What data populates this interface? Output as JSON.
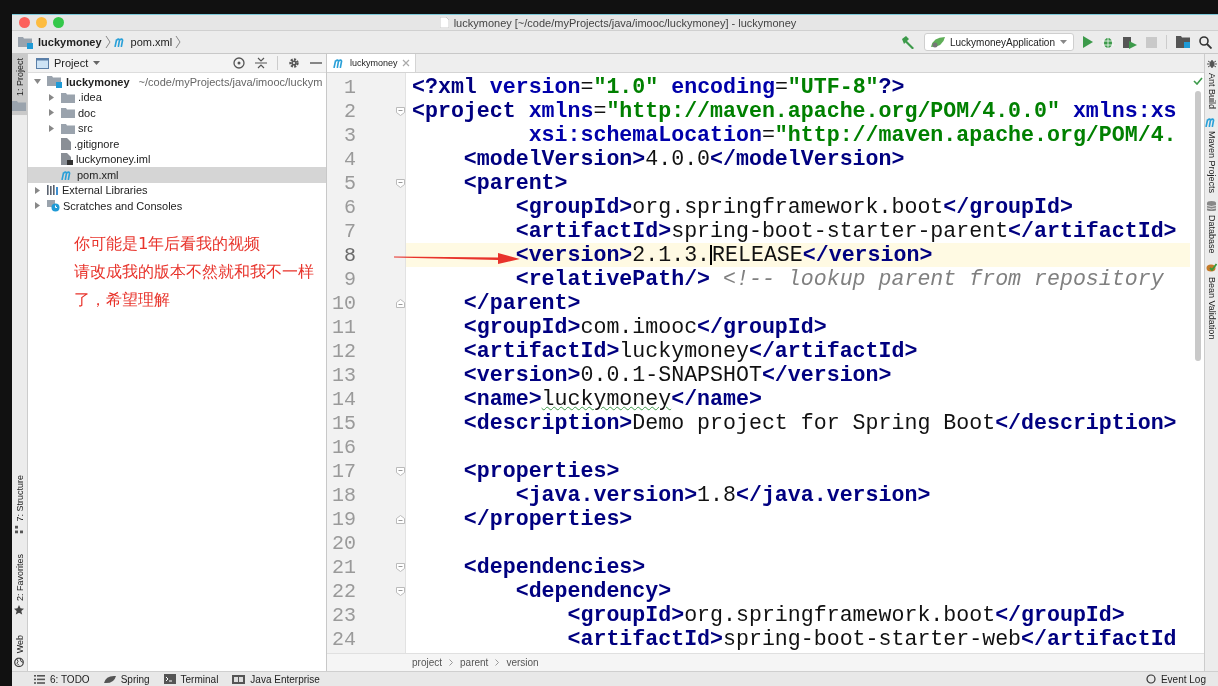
{
  "window": {
    "title": "luckymoney [~/code/myProjects/java/imooc/luckymoney] - luckymoney"
  },
  "navbar": {
    "breadcrumbs": [
      {
        "label": "luckymoney",
        "kind": "project"
      },
      {
        "label": "pom.xml",
        "kind": "maven"
      }
    ],
    "run_config": "LuckymoneyApplication"
  },
  "left_stripe": [
    {
      "label": "1: Project",
      "kind": "folder",
      "selected": true
    },
    {
      "label": "7: Structure",
      "kind": "structure",
      "selected": false
    },
    {
      "label": "2: Favorites",
      "kind": "star",
      "selected": false
    },
    {
      "label": "Web",
      "kind": "globe",
      "selected": false
    }
  ],
  "project_panel": {
    "title": "Project",
    "tree": [
      {
        "label": "luckymoney",
        "path": "~/code/myProjects/java/imooc/luckym",
        "kind": "module",
        "expanded": true,
        "selected": false,
        "children": [
          {
            "label": ".idea",
            "kind": "folder",
            "expanded": false,
            "selected": false
          },
          {
            "label": "doc",
            "kind": "folder",
            "expanded": false,
            "selected": false
          },
          {
            "label": "src",
            "kind": "folder",
            "expanded": false,
            "selected": false
          },
          {
            "label": ".gitignore",
            "kind": "text-file",
            "selected": false
          },
          {
            "label": "luckymoney.iml",
            "kind": "module-file",
            "selected": false
          },
          {
            "label": "pom.xml",
            "kind": "maven",
            "selected": true
          }
        ]
      },
      {
        "label": "External Libraries",
        "kind": "libraries",
        "expanded": false,
        "selected": false
      },
      {
        "label": "Scratches and Consoles",
        "kind": "scratches",
        "expanded": false,
        "selected": false
      }
    ]
  },
  "editor": {
    "tabs": [
      {
        "label": "luckymoney",
        "selected": true
      }
    ],
    "lines": [
      {
        "number": "1",
        "current": false,
        "fold_start": false,
        "fold_end": false,
        "segments": [
          {
            "kind": "tag",
            "text": "<?xml "
          },
          {
            "kind": "attr",
            "text": "version"
          },
          {
            "kind": "text",
            "text": "="
          },
          {
            "kind": "value",
            "text": "\"1.0\""
          },
          {
            "kind": "attr",
            "text": " encoding"
          },
          {
            "kind": "text",
            "text": "="
          },
          {
            "kind": "value",
            "text": "\"UTF-8\""
          },
          {
            "kind": "tag",
            "text": "?>"
          }
        ]
      },
      {
        "number": "2",
        "current": false,
        "fold_start": true,
        "fold_end": false,
        "segments": [
          {
            "kind": "tag",
            "text": "<project "
          },
          {
            "kind": "attr",
            "text": "xmlns"
          },
          {
            "kind": "text",
            "text": "="
          },
          {
            "kind": "value",
            "text": "\"http://maven.apache.org/POM/4.0.0\""
          },
          {
            "kind": "attr",
            "text": " xmlns:xs"
          }
        ]
      },
      {
        "number": "3",
        "current": false,
        "fold_start": false,
        "fold_end": false,
        "segments": [
          {
            "kind": "attr",
            "text": "         xsi:schemaLocation"
          },
          {
            "kind": "text",
            "text": "="
          },
          {
            "kind": "value",
            "text": "\"http://maven.apache.org/POM/4."
          }
        ]
      },
      {
        "number": "4",
        "current": false,
        "fold_start": false,
        "fold_end": false,
        "segments": [
          {
            "kind": "tag",
            "text": "    <modelVersion>"
          },
          {
            "kind": "text",
            "text": "4.0.0"
          },
          {
            "kind": "tag",
            "text": "</modelVersion>"
          }
        ]
      },
      {
        "number": "5",
        "current": false,
        "fold_start": true,
        "fold_end": false,
        "segments": [
          {
            "kind": "tag",
            "text": "    <parent>"
          }
        ]
      },
      {
        "number": "6",
        "current": false,
        "fold_start": false,
        "fold_end": false,
        "segments": [
          {
            "kind": "tag",
            "text": "        <groupId>"
          },
          {
            "kind": "text",
            "text": "org.springframework.boot"
          },
          {
            "kind": "tag",
            "text": "</groupId>"
          }
        ]
      },
      {
        "number": "7",
        "current": false,
        "fold_start": false,
        "fold_end": false,
        "segments": [
          {
            "kind": "tag",
            "text": "        <artifactId>"
          },
          {
            "kind": "text",
            "text": "spring-boot-starter-parent"
          },
          {
            "kind": "tag",
            "text": "</artifactId>"
          }
        ]
      },
      {
        "number": "8",
        "current": true,
        "fold_start": false,
        "fold_end": false,
        "segments": [
          {
            "kind": "tag",
            "text": "        <version>"
          },
          {
            "kind": "text",
            "text": "2.1.3."
          },
          {
            "kind": "caret"
          },
          {
            "kind": "text",
            "text": "RELEASE"
          },
          {
            "kind": "tag",
            "text": "</version>"
          }
        ]
      },
      {
        "number": "9",
        "current": false,
        "fold_start": false,
        "fold_end": false,
        "segments": [
          {
            "kind": "tag",
            "text": "        <relativePath/> "
          },
          {
            "kind": "comment",
            "text": "<!-- lookup parent from repository"
          }
        ]
      },
      {
        "number": "10",
        "current": false,
        "fold_start": false,
        "fold_end": true,
        "segments": [
          {
            "kind": "tag",
            "text": "    </parent>"
          }
        ]
      },
      {
        "number": "11",
        "current": false,
        "fold_start": false,
        "fold_end": false,
        "segments": [
          {
            "kind": "tag",
            "text": "    <groupId>"
          },
          {
            "kind": "text",
            "text": "com.imooc"
          },
          {
            "kind": "tag",
            "text": "</groupId>"
          }
        ]
      },
      {
        "number": "12",
        "current": false,
        "fold_start": false,
        "fold_end": false,
        "segments": [
          {
            "kind": "tag",
            "text": "    <artifactId>"
          },
          {
            "kind": "text",
            "text": "luckymoney"
          },
          {
            "kind": "tag",
            "text": "</artifactId>"
          }
        ]
      },
      {
        "number": "13",
        "current": false,
        "fold_start": false,
        "fold_end": false,
        "segments": [
          {
            "kind": "tag",
            "text": "    <version>"
          },
          {
            "kind": "text",
            "text": "0.0.1-SNAPSHOT"
          },
          {
            "kind": "tag",
            "text": "</version>"
          }
        ]
      },
      {
        "number": "14",
        "current": false,
        "fold_start": false,
        "fold_end": false,
        "segments": [
          {
            "kind": "tag",
            "text": "    <name>"
          },
          {
            "kind": "typo",
            "text": "luckymoney"
          },
          {
            "kind": "tag",
            "text": "</name>"
          }
        ]
      },
      {
        "number": "15",
        "current": false,
        "fold_start": false,
        "fold_end": false,
        "segments": [
          {
            "kind": "tag",
            "text": "    <description>"
          },
          {
            "kind": "text",
            "text": "Demo project for Spring Boot"
          },
          {
            "kind": "tag",
            "text": "</description>"
          }
        ]
      },
      {
        "number": "16",
        "current": false,
        "fold_start": false,
        "fold_end": false
      },
      {
        "number": "17",
        "current": false,
        "fold_start": true,
        "fold_end": false,
        "segments": [
          {
            "kind": "tag",
            "text": "    <properties>"
          }
        ]
      },
      {
        "number": "18",
        "current": false,
        "fold_start": false,
        "fold_end": false,
        "segments": [
          {
            "kind": "tag",
            "text": "        <java.version>"
          },
          {
            "kind": "text",
            "text": "1.8"
          },
          {
            "kind": "tag",
            "text": "</java.version>"
          }
        ]
      },
      {
        "number": "19",
        "current": false,
        "fold_start": false,
        "fold_end": true,
        "segments": [
          {
            "kind": "tag",
            "text": "    </properties>"
          }
        ]
      },
      {
        "number": "20",
        "current": false,
        "fold_start": false,
        "fold_end": false
      },
      {
        "number": "21",
        "current": false,
        "fold_start": true,
        "fold_end": false,
        "segments": [
          {
            "kind": "tag",
            "text": "    <dependencies>"
          }
        ]
      },
      {
        "number": "22",
        "current": false,
        "fold_start": true,
        "fold_end": false,
        "segments": [
          {
            "kind": "tag",
            "text": "        <dependency>"
          }
        ]
      },
      {
        "number": "23",
        "current": false,
        "fold_start": false,
        "fold_end": false,
        "segments": [
          {
            "kind": "tag",
            "text": "            <groupId>"
          },
          {
            "kind": "text",
            "text": "org.springframework.boot"
          },
          {
            "kind": "tag",
            "text": "</groupId>"
          }
        ]
      },
      {
        "number": "24",
        "current": false,
        "fold_start": false,
        "fold_end": false,
        "segments": [
          {
            "kind": "tag",
            "text": "            <artifactId>"
          },
          {
            "kind": "text",
            "text": "spring-boot-starter-web"
          },
          {
            "kind": "tag",
            "text": "</artifactId"
          }
        ]
      }
    ],
    "breadcrumbs": [
      "project",
      "parent",
      "version"
    ]
  },
  "right_stripe": [
    {
      "label": "Ant Build",
      "kind": "ant"
    },
    {
      "label": "Maven Projects",
      "kind": "maven"
    },
    {
      "label": "Database",
      "kind": "database"
    },
    {
      "label": "Bean Validation",
      "kind": "bean"
    }
  ],
  "bottom_bar": {
    "tools": [
      {
        "label": "6: TODO",
        "kind": "list"
      },
      {
        "label": "Spring",
        "kind": "leaf"
      },
      {
        "label": "Terminal",
        "kind": "terminal"
      },
      {
        "label": "Java Enterprise",
        "kind": "enterprise"
      }
    ],
    "event_log": "Event Log"
  },
  "annotation": {
    "lines": [
      "你可能是1年后看我的视频",
      "请改成我的版本不然就和我不一样",
      "了，希望理解"
    ]
  }
}
